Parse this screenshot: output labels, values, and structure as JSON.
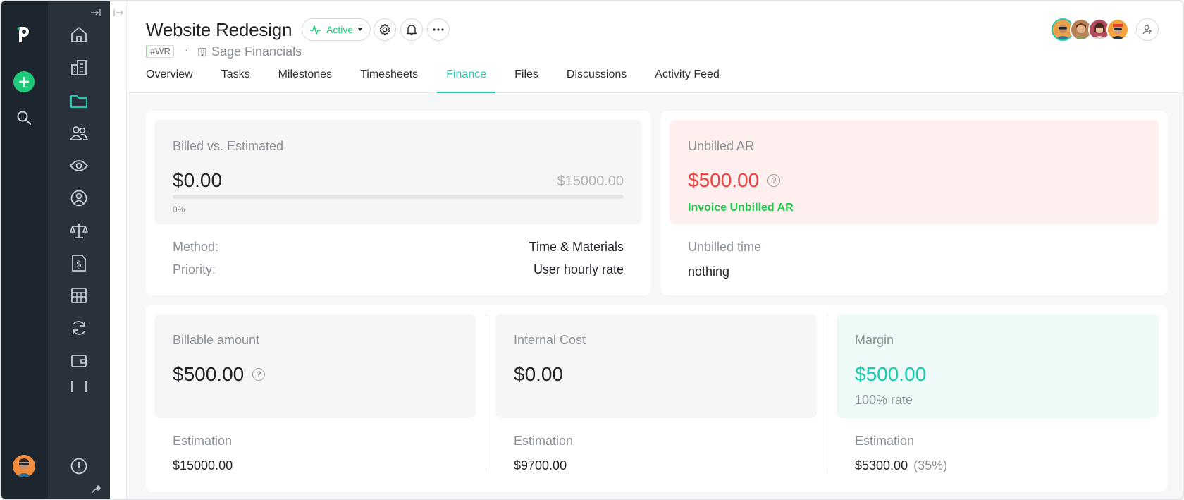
{
  "sidebar_nav": {
    "items": [
      "home-icon",
      "buildings-icon",
      "folder-icon",
      "people-icon",
      "eye-icon",
      "user-circle-icon",
      "scales-icon",
      "invoice-dollar-icon",
      "table-icon",
      "refresh-icon",
      "wallet-icon",
      "more-icon"
    ],
    "active": "folder-icon"
  },
  "header": {
    "title": "Website Redesign",
    "status": "Active",
    "project_code": "#WR",
    "separator": "·",
    "client": "Sage Financials"
  },
  "tabs": [
    {
      "label": "Overview"
    },
    {
      "label": "Tasks"
    },
    {
      "label": "Milestones"
    },
    {
      "label": "Timesheets"
    },
    {
      "label": "Finance",
      "active": true
    },
    {
      "label": "Files"
    },
    {
      "label": "Discussions"
    },
    {
      "label": "Activity Feed"
    }
  ],
  "billed": {
    "title": "Billed vs. Estimated",
    "billed_amount": "$0.00",
    "estimated_amount": "$15000.00",
    "progress_percent": "0%",
    "progress": 0,
    "method_label": "Method:",
    "method_value": "Time & Materials",
    "priority_label": "Priority:",
    "priority_value": "User hourly rate"
  },
  "unbilled": {
    "title": "Unbilled AR",
    "amount": "$500.00",
    "action": "Invoice Unbilled AR",
    "time_label": "Unbilled time",
    "time_value": "nothing"
  },
  "billable": {
    "title": "Billable amount",
    "amount": "$500.00",
    "estimation_label": "Estimation",
    "estimation_value": "$15000.00"
  },
  "internal_cost": {
    "title": "Internal Cost",
    "amount": "$0.00",
    "estimation_label": "Estimation",
    "estimation_value": "$9700.00"
  },
  "margin": {
    "title": "Margin",
    "amount": "$500.00",
    "rate": "100% rate",
    "estimation_label": "Estimation",
    "estimation_value": "$5300.00",
    "estimation_pct": "(35%)"
  },
  "colors": {
    "accent": "#1ec9b0",
    "green": "#1ec97a",
    "red": "#f0413f",
    "unbilled_bg": "#fff0ef",
    "margin_bg": "#eefaf7"
  }
}
